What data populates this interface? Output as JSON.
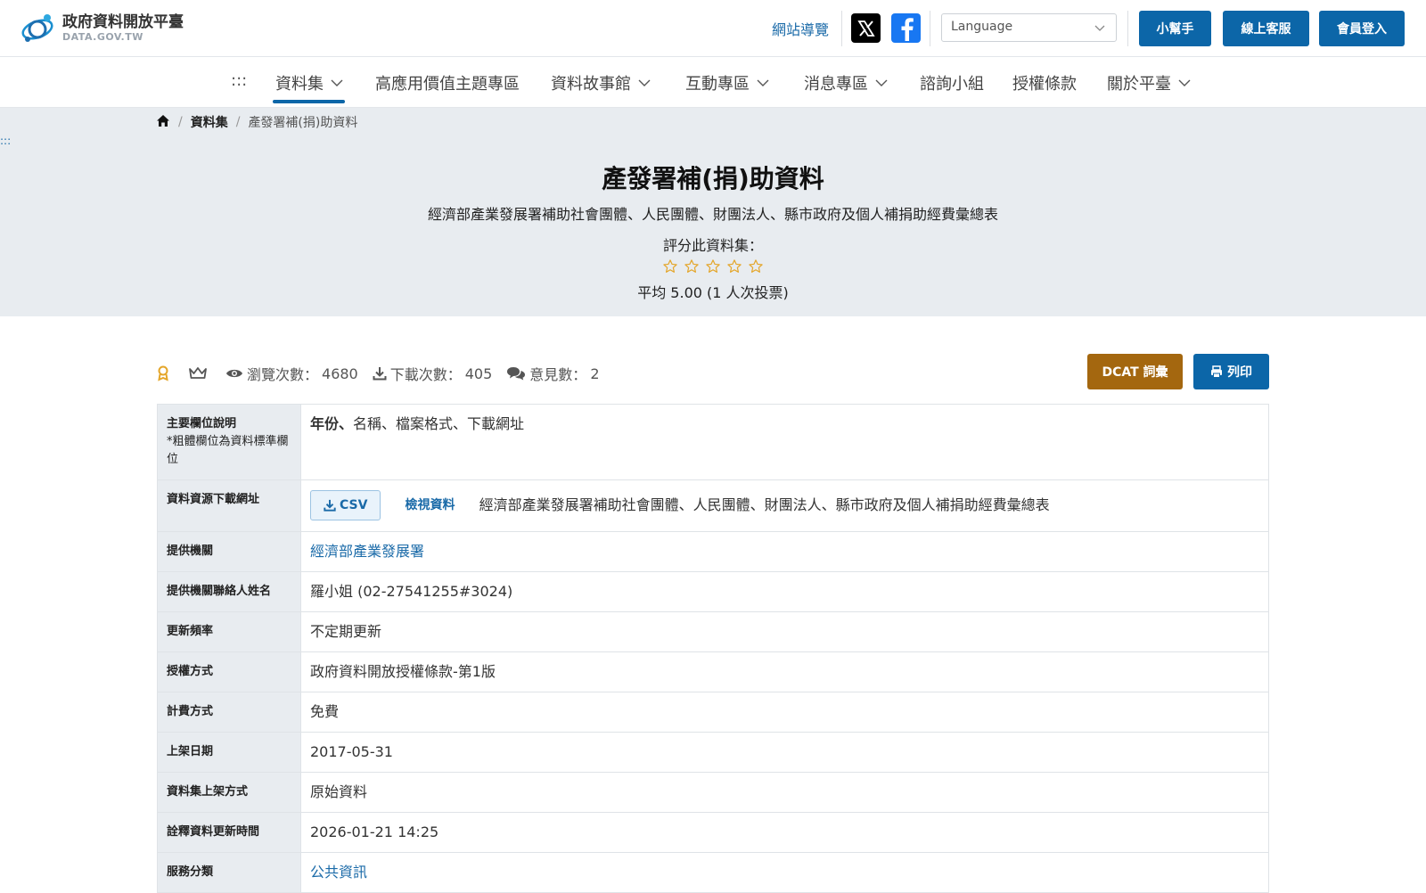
{
  "header": {
    "logo_title": "政府資料開放平臺",
    "logo_subtitle": "DATA.GOV.TW",
    "site_nav": "網站導覽",
    "language_placeholder": "Language",
    "buttons": {
      "helper": "小幫手",
      "service": "線上客服",
      "login": "會員登入"
    }
  },
  "nav": {
    "skip": ":::",
    "items": [
      {
        "label": "資料集",
        "has_dropdown": true,
        "active": true
      },
      {
        "label": "高應用價值主題專區",
        "has_dropdown": false
      },
      {
        "label": "資料故事館",
        "has_dropdown": true
      },
      {
        "label": "互動專區",
        "has_dropdown": true
      },
      {
        "label": "消息專區",
        "has_dropdown": true
      },
      {
        "label": "諮詢小組",
        "has_dropdown": false
      },
      {
        "label": "授權條款",
        "has_dropdown": false
      },
      {
        "label": "關於平臺",
        "has_dropdown": true
      }
    ]
  },
  "breadcrumb": {
    "level1": "資料集",
    "current": "產發署補(捐)助資料"
  },
  "skip_anchor": ":::",
  "dataset": {
    "title": "產發署補(捐)助資料",
    "description": "經濟部產業發展署補助社會團體、人民團體、財團法人、縣市政府及個人補捐助經費彙總表",
    "rate_label": "評分此資料集：",
    "star_count": 5,
    "average": "平均 5.00 (1 人次投票)"
  },
  "stats": {
    "views_label": "瀏覽次數：",
    "views": "4680",
    "downloads_label": "下載次數：",
    "downloads": "405",
    "comments_label": "意見數：",
    "comments": "2"
  },
  "actions": {
    "dcat": "DCAT 詞彙",
    "print": "列印"
  },
  "colors": {
    "primary": "#0c66a8",
    "dcat": "#a4670f",
    "hero_bg": "#e8ecf0",
    "star": "#e4a62a"
  },
  "meta": {
    "main_fields": {
      "label": "主要欄位說明",
      "note": "*粗體欄位為資料標準欄位",
      "bold_field": "年份、",
      "other_fields": "名稱、檔案格式、下載網址"
    },
    "resource": {
      "label": "資料資源下載網址",
      "format": "CSV",
      "view": "檢視資料",
      "desc": "經濟部產業發展署補助社會團體、人民團體、財團法人、縣市政府及個人補捐助經費彙總表"
    },
    "provider": {
      "label": "提供機關",
      "value": "經濟部產業發展署"
    },
    "contact": {
      "label": "提供機關聯絡人姓名",
      "value": "羅小姐 (02-27541255#3024)"
    },
    "frequency": {
      "label": "更新頻率",
      "value": "不定期更新"
    },
    "license": {
      "label": "授權方式",
      "value": "政府資料開放授權條款-第1版"
    },
    "fee": {
      "label": "計費方式",
      "value": "免費"
    },
    "published": {
      "label": "上架日期",
      "value": "2017-05-31"
    },
    "method": {
      "label": "資料集上架方式",
      "value": "原始資料"
    },
    "meta_updated": {
      "label": "詮釋資料更新時間",
      "value": "2026-01-21 14:25"
    },
    "category": {
      "label": "服務分類",
      "value": "公共資訊"
    }
  }
}
